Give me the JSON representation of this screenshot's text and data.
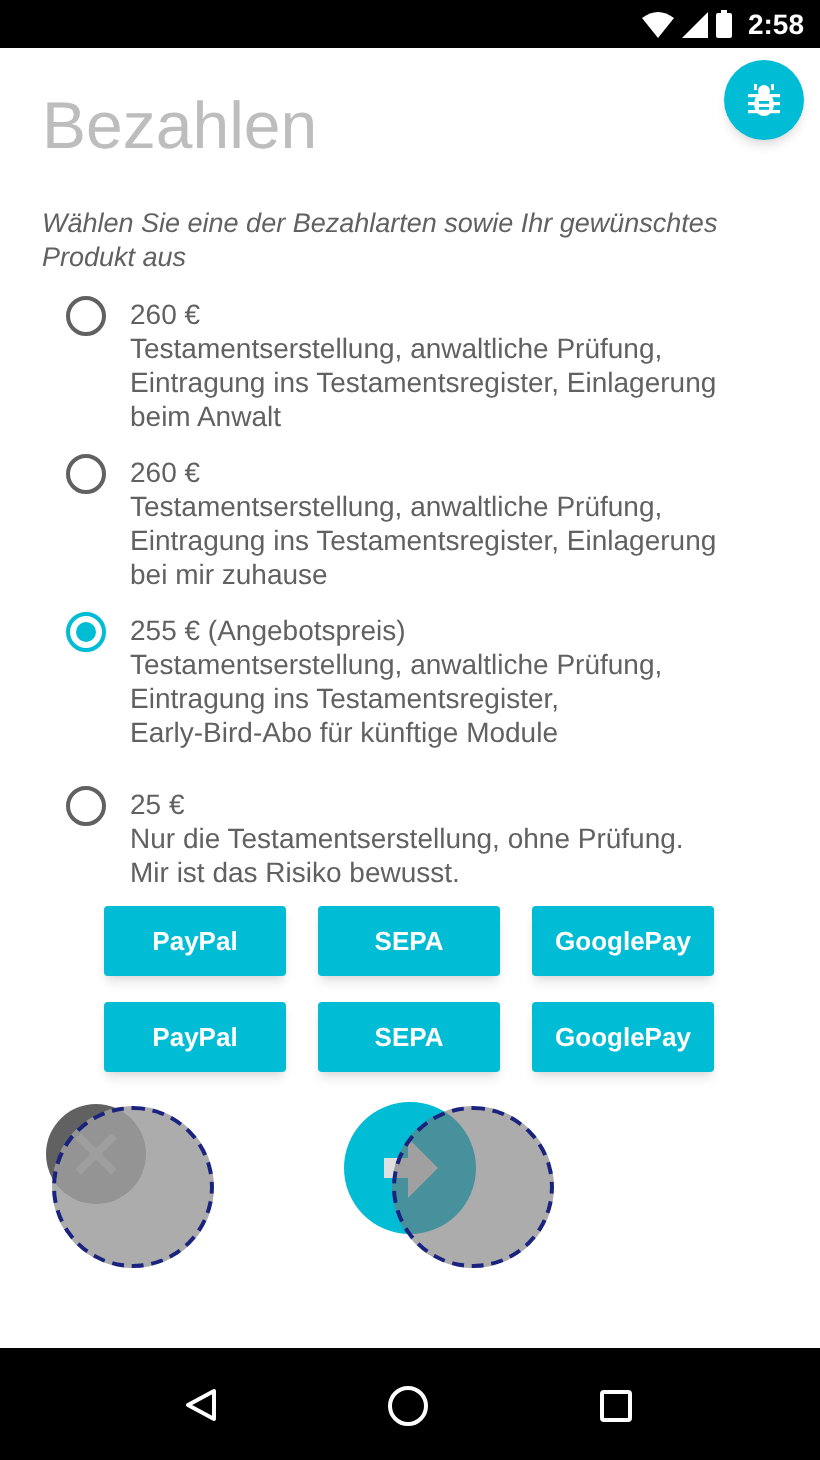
{
  "status_bar": {
    "time": "2:58"
  },
  "title": "Bezahlen",
  "instruction": "Wählen Sie eine der Bezahlarten sowie Ihr gewünschtes Produkt aus",
  "options": [
    {
      "price": "260 €",
      "lines": [
        "Testamentserstellung, anwaltliche Prüfung,",
        "Eintragung ins Testamentsregister, Einlagerung",
        "beim Anwalt"
      ],
      "selected": false
    },
    {
      "price": "260 €",
      "lines": [
        "Testamentserstellung, anwaltliche Prüfung,",
        "Eintragung ins Testamentsregister, Einlagerung",
        "bei mir zuhause"
      ],
      "selected": false
    },
    {
      "price": "255 € (Angebotspreis)",
      "lines": [
        "Testamentserstellung, anwaltliche Prüfung,",
        "Eintragung ins Testamentsregister,",
        "Early-Bird-Abo für künftige Module"
      ],
      "selected": true
    },
    {
      "price": "25 €",
      "lines": [
        "Nur die Testamentserstellung, ohne Prüfung.",
        "Mir ist das Risiko bewusst."
      ],
      "selected": false
    }
  ],
  "payment_rows": [
    [
      "PayPal",
      "SEPA",
      "GooglePay"
    ],
    [
      "PayPal",
      "SEPA",
      "GooglePay"
    ]
  ]
}
